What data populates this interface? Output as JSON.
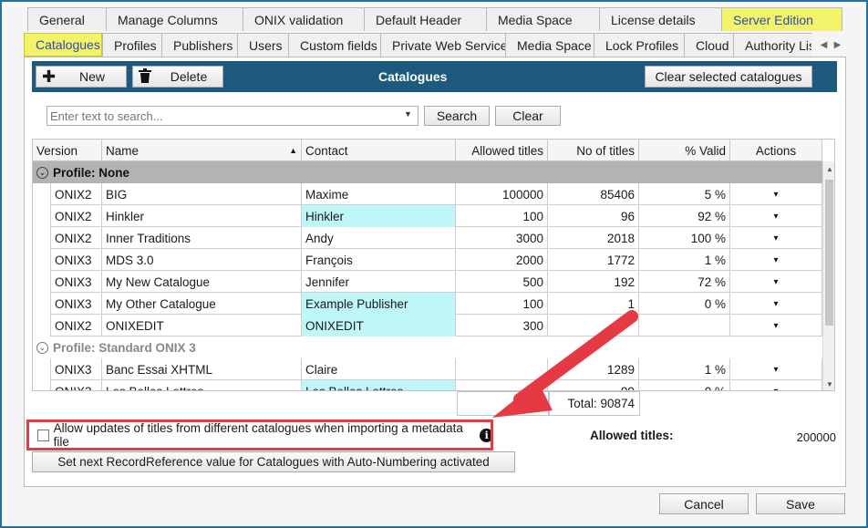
{
  "tabs_row1": [
    "General",
    "Manage Columns",
    "ONIX validation",
    "Default Header",
    "Media Space",
    "License details",
    "Server Edition"
  ],
  "tabs_row2": [
    "Catalogues",
    "Profiles",
    "Publishers",
    "Users",
    "Custom fields",
    "Private Web Service",
    "Media Space",
    "Lock Profiles",
    "Cloud",
    "Authority List"
  ],
  "toolbar": {
    "new_label": "New",
    "delete_label": "Delete",
    "title": "Catalogues",
    "clear_selected_label": "Clear selected catalogues"
  },
  "search": {
    "placeholder": "Enter text to search...",
    "search_label": "Search",
    "clear_label": "Clear"
  },
  "grid": {
    "columns": [
      "Version",
      "Name",
      "Contact",
      "Allowed titles",
      "No of titles",
      "% Valid",
      "Actions"
    ],
    "group1": "Profile: None",
    "group2": "Profile: Standard ONIX 3",
    "rows1": [
      {
        "version": "ONIX2",
        "name": "BIG",
        "contact": "Maxime",
        "allowed": "100000",
        "count": "85406",
        "valid": "5 %",
        "hl": false
      },
      {
        "version": "ONIX2",
        "name": "Hinkler",
        "contact": "Hinkler",
        "allowed": "100",
        "count": "96",
        "valid": "92 %",
        "hl": true
      },
      {
        "version": "ONIX2",
        "name": "Inner Traditions",
        "contact": "Andy",
        "allowed": "3000",
        "count": "2018",
        "valid": "100 %",
        "hl": false
      },
      {
        "version": "ONIX3",
        "name": "MDS 3.0",
        "contact": "François",
        "allowed": "2000",
        "count": "1772",
        "valid": "1 %",
        "hl": false
      },
      {
        "version": "ONIX3",
        "name": "My New Catalogue",
        "contact": "Jennifer",
        "allowed": "500",
        "count": "192",
        "valid": "72 %",
        "hl": false
      },
      {
        "version": "ONIX3",
        "name": "My Other Catalogue",
        "contact": "Example Publisher",
        "allowed": "100",
        "count": "1",
        "valid": "0 %",
        "hl": true
      },
      {
        "version": "ONIX2",
        "name": "ONIXEDIT",
        "contact": "ONIXEDIT",
        "allowed": "300",
        "count": "",
        "valid": "",
        "hl": true
      }
    ],
    "rows2": [
      {
        "version": "ONIX3",
        "name": "Banc Essai XHTML",
        "contact": "Claire",
        "allowed": "",
        "count": "1289",
        "valid": "1 %",
        "hl": false
      },
      {
        "version": "ONIX3",
        "name": "Les Belles Lettres",
        "contact": "Les Belles Lettres",
        "allowed": "",
        "count": "99",
        "valid": "0 %",
        "hl": true
      }
    ],
    "actions_glyph": "▾"
  },
  "totals": {
    "total_label": "Total:",
    "titles_total": "Total: 90874"
  },
  "allow_updates_label": "Allow updates of titles from different catalogues when importing a metadata file",
  "allowed_titles_label": "Allowed titles:",
  "allowed_titles_value": "200000",
  "recordref_label": "Set next RecordReference value for Catalogues with Auto-Numbering activated",
  "cancel_label": "Cancel",
  "save_label": "Save",
  "colors": {
    "toolbar": "#1e5a7e",
    "active_tab": "#f3f36b",
    "cell_highlight": "#bff6f8",
    "annotation_red": "#e53a44"
  }
}
